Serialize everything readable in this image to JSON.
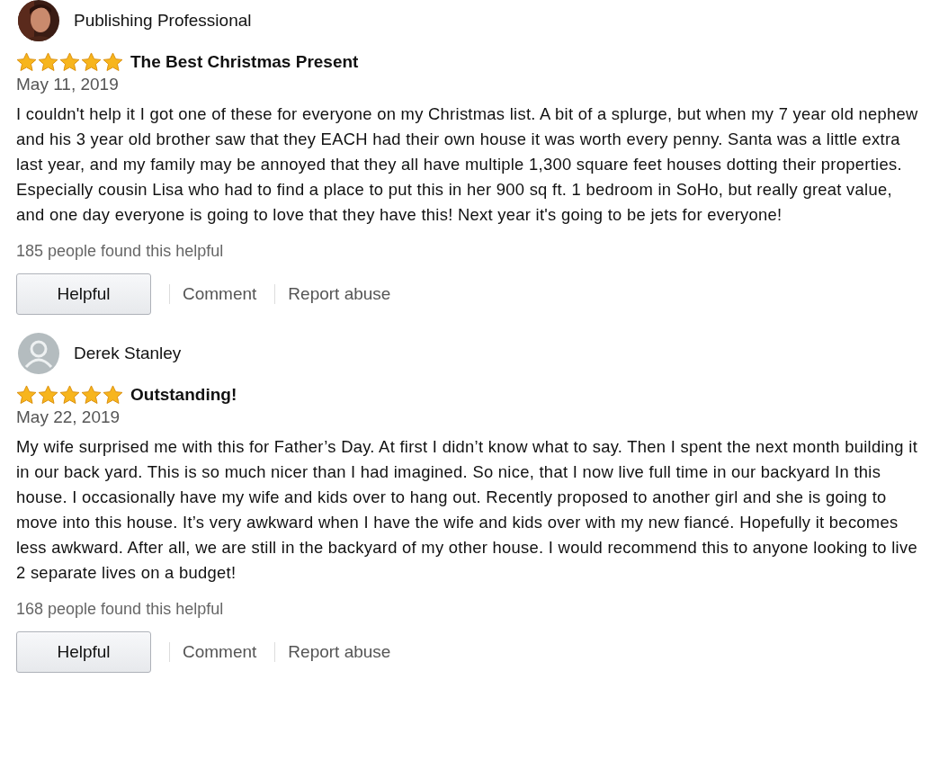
{
  "reviews": [
    {
      "author": "Publishing Professional",
      "stars": 5,
      "title": "The Best Christmas Present",
      "date": "May 11, 2019",
      "body": "I couldn't help it I got one of these for everyone on my Christmas list. A bit of a splurge, but when my 7 year old nephew and his 3 year old brother saw that they EACH had their own house it was worth every penny. Santa was a little extra last year, and my family may be annoyed that they all have multiple 1,300 square feet houses dotting their properties. Especially cousin Lisa who had to find a place to put this in her 900 sq ft. 1 bedroom in SoHo, but really great value, and one day everyone is going to love that they have this! Next year it's going to be jets for everyone!",
      "helpful_count": "185 people found this helpful",
      "actions": [
        "Helpful",
        "Comment",
        "Report abuse"
      ]
    },
    {
      "author": "Derek Stanley",
      "avatar": {
        "kind": "default"
      },
      "stars": 5,
      "title": "Outstanding!",
      "date": "May 22, 2019",
      "body": "My wife surprised me with this for Father’s Day. At first I didn’t know what to say. Then I spent the next month building it in our back yard. This is so much nicer than I had imagined. So nice, that I now live full time in our backyard In this house. I occasionally have my wife and kids over to hang out. Recently proposed to another girl and she is going to move into this house. It’s very awkward when I have the wife and kids over with my new fiancé. Hopefully it becomes less awkward. After all, we are still in the backyard of my other house. I would recommend this to anyone looking to live 2 separate lives on a budget!",
      "helpful_count": "168 people found this helpful",
      "actions": [
        "Helpful",
        "Comment",
        "Report abuse"
      ]
    }
  ]
}
